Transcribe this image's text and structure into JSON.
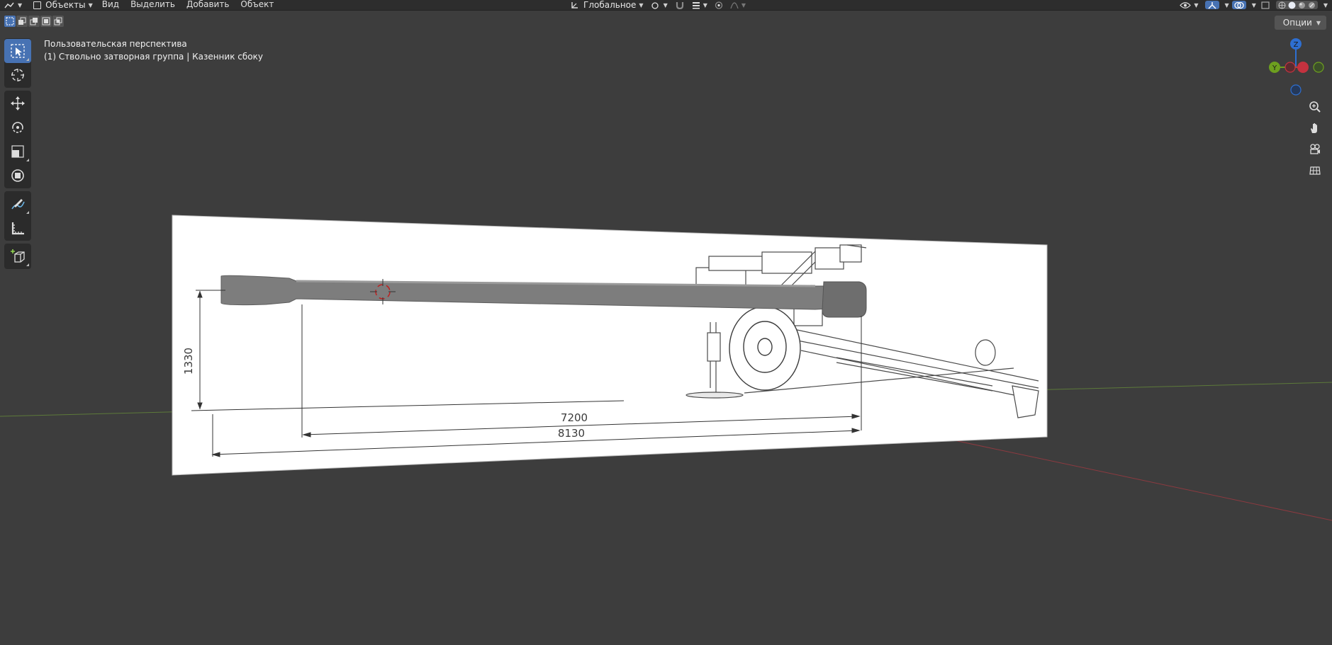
{
  "header": {
    "mode_label": "Объекты",
    "menus": [
      "Вид",
      "Выделить",
      "Добавить",
      "Объект"
    ],
    "orientation_label": "Глобальное"
  },
  "options_label": "Опции",
  "viewport": {
    "view_name": "Пользовательская перспектива",
    "object_info": "(1) Ствольно затворная группа | Казенник сбоку"
  },
  "gizmo": {
    "z": "Z",
    "y": "Y"
  },
  "drawing": {
    "height_dim": "1330",
    "length_dim_1": "7200",
    "length_dim_2": "8130"
  },
  "colors": {
    "accent": "#4772b3",
    "axis_x": "#c4323f",
    "axis_y": "#6d9f1f",
    "axis_z": "#2e6fd1",
    "grid_green": "#5d7a3a"
  }
}
